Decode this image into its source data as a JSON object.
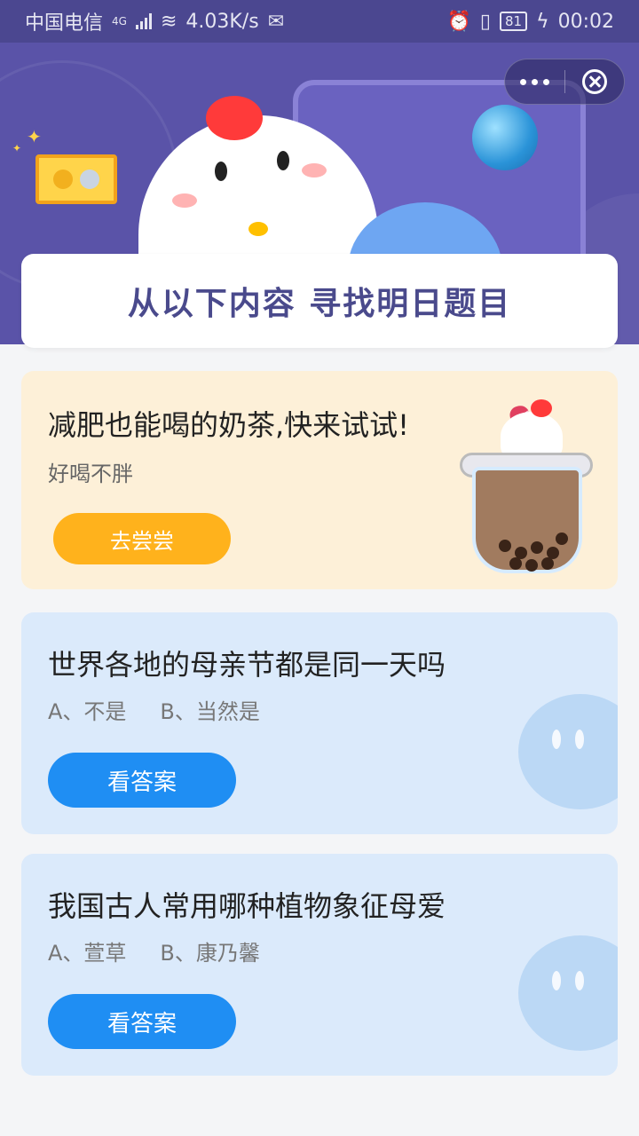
{
  "status_bar": {
    "carrier": "中国电信",
    "network": "4G",
    "speed": "4.03K/s",
    "battery": "81",
    "time": "00:02"
  },
  "capsule": {
    "more_icon": "more-dots-icon",
    "close_icon": "close-circle-icon"
  },
  "header": {
    "title": "从以下内容 寻找明日题目"
  },
  "promo": {
    "title": "减肥也能喝的奶茶,快来试试!",
    "subtitle": "好喝不胖",
    "button_label": "去尝尝"
  },
  "questions": [
    {
      "title": "世界各地的母亲节都是同一天吗",
      "option_a": "A、不是",
      "option_b": "B、当然是",
      "button_label": "看答案"
    },
    {
      "title": "我国古人常用哪种植物象征母爱",
      "option_a": "A、萱草",
      "option_b": "B、康乃馨",
      "button_label": "看答案"
    }
  ],
  "colors": {
    "banner": "#5a53a8",
    "promo_bg": "#fdf0d8",
    "promo_button": "#ffb21c",
    "question_bg": "#dbeafb",
    "answer_button": "#1f8ef3"
  }
}
